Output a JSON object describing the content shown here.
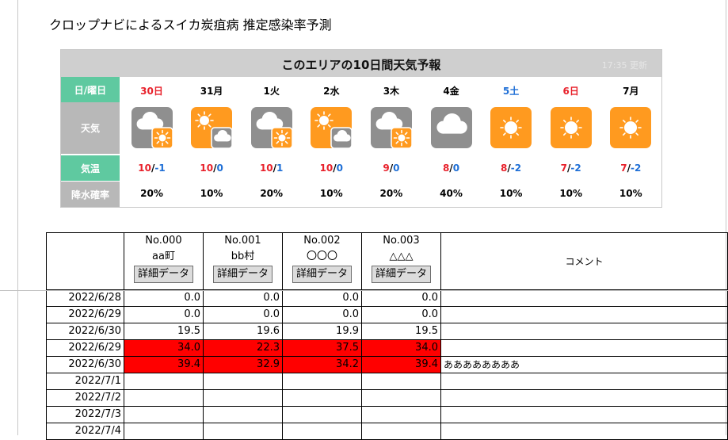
{
  "page_title": "クロップナビによるスイカ炭疽病 推定感染率予測",
  "weather": {
    "title": "このエリアの10日間天気予報",
    "updated": "17:35 更新",
    "row_labels": {
      "day": "日/曜日",
      "weather": "天気",
      "temp": "気温",
      "rain": "降水確率"
    },
    "days": [
      {
        "label": "30日",
        "color": "red",
        "icon": "cloud-sun-icon",
        "high": "10",
        "low": "-1",
        "high_color": "red",
        "low_color": "blue",
        "rain": "20%"
      },
      {
        "label": "31月",
        "color": "black",
        "icon": "sun-cloud-icon",
        "high": "10",
        "low": "0",
        "high_color": "red",
        "low_color": "blue",
        "rain": "10%"
      },
      {
        "label": "1火",
        "color": "black",
        "icon": "cloud-sun-icon",
        "high": "10",
        "low": "1",
        "high_color": "red",
        "low_color": "blue",
        "rain": "20%"
      },
      {
        "label": "2水",
        "color": "black",
        "icon": "sun-cloud-icon",
        "high": "10",
        "low": "0",
        "high_color": "red",
        "low_color": "blue",
        "rain": "10%"
      },
      {
        "label": "3木",
        "color": "black",
        "icon": "cloud-sun-icon",
        "high": "9",
        "low": "0",
        "high_color": "red",
        "low_color": "blue",
        "rain": "20%"
      },
      {
        "label": "4金",
        "color": "black",
        "icon": "cloud-icon",
        "high": "8",
        "low": "0",
        "high_color": "red",
        "low_color": "blue",
        "rain": "40%"
      },
      {
        "label": "5土",
        "color": "blue",
        "icon": "sun-icon",
        "high": "8",
        "low": "-2",
        "high_color": "red",
        "low_color": "blue",
        "rain": "10%"
      },
      {
        "label": "6日",
        "color": "red",
        "icon": "sun-icon",
        "high": "7",
        "low": "-2",
        "high_color": "red",
        "low_color": "blue",
        "rain": "10%"
      },
      {
        "label": "7月",
        "color": "black",
        "icon": "sun-icon",
        "high": "7",
        "low": "-2",
        "high_color": "red",
        "low_color": "blue",
        "rain": "10%"
      }
    ]
  },
  "table": {
    "stations": [
      {
        "no": "No.000",
        "name": "aa町",
        "button": "詳細データ"
      },
      {
        "no": "No.001",
        "name": "bb村",
        "button": "詳細データ"
      },
      {
        "no": "No.002",
        "name": "〇〇〇",
        "button": "詳細データ"
      },
      {
        "no": "No.003",
        "name": "△△△",
        "button": "詳細データ"
      }
    ],
    "comment_header": "コメント",
    "rows": [
      {
        "date": "2022/6/28",
        "values": [
          "0.0",
          "0.0",
          "0.0",
          "0.0"
        ],
        "highlight": false,
        "comment": ""
      },
      {
        "date": "2022/6/29",
        "values": [
          "0.0",
          "0.0",
          "0.0",
          "0.0"
        ],
        "highlight": false,
        "comment": ""
      },
      {
        "date": "2022/6/30",
        "values": [
          "19.5",
          "19.6",
          "19.9",
          "19.5"
        ],
        "highlight": false,
        "comment": ""
      },
      {
        "date": "2022/6/29",
        "values": [
          "34.0",
          "22.3",
          "37.5",
          "34.0"
        ],
        "highlight": true,
        "comment": ""
      },
      {
        "date": "2022/6/30",
        "values": [
          "39.4",
          "32.9",
          "34.2",
          "39.4"
        ],
        "highlight": true,
        "comment": "ああああああああ"
      },
      {
        "date": "2022/7/1",
        "values": [
          "",
          "",
          "",
          ""
        ],
        "highlight": false,
        "comment": ""
      },
      {
        "date": "2022/7/2",
        "values": [
          "",
          "",
          "",
          ""
        ],
        "highlight": false,
        "comment": ""
      },
      {
        "date": "2022/7/3",
        "values": [
          "",
          "",
          "",
          ""
        ],
        "highlight": false,
        "comment": ""
      },
      {
        "date": "2022/7/4",
        "values": [
          "",
          "",
          "",
          ""
        ],
        "highlight": false,
        "comment": ""
      }
    ]
  },
  "colors": {
    "label_green": "#5fc9a0",
    "label_gray": "#b8b8b8",
    "highlight": "#ff0000",
    "weather_orange": "#ff9a1f",
    "weather_gray": "#8f8f8f"
  }
}
